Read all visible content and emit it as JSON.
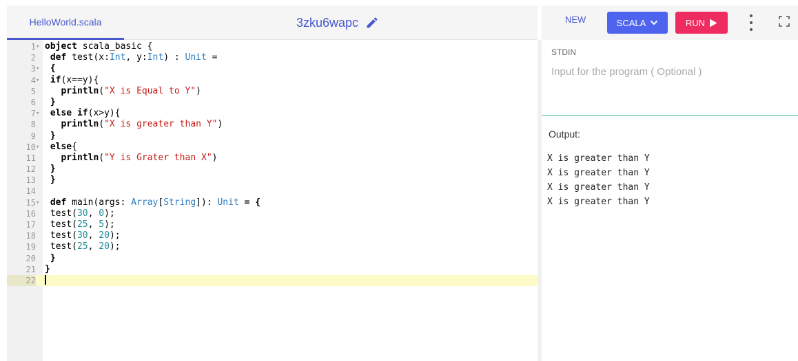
{
  "header": {
    "file_tab": "HelloWorld.scala",
    "project_name": "3zku6wapc",
    "edit_icon": "pencil-icon"
  },
  "toolbar": {
    "new_label": "NEW",
    "language_label": "SCALA",
    "run_label": "RUN",
    "colors": {
      "language": "#4e64ee",
      "run": "#ee2c62",
      "accent": "#4a59ce"
    }
  },
  "editor": {
    "active_line": 22,
    "lines": [
      {
        "n": "1",
        "fold": true
      },
      {
        "n": "2",
        "fold": false
      },
      {
        "n": "3",
        "fold": true
      },
      {
        "n": "4",
        "fold": true
      },
      {
        "n": "5",
        "fold": false
      },
      {
        "n": "6",
        "fold": false
      },
      {
        "n": "7",
        "fold": true
      },
      {
        "n": "8",
        "fold": false
      },
      {
        "n": "9",
        "fold": false
      },
      {
        "n": "10",
        "fold": true
      },
      {
        "n": "11",
        "fold": false
      },
      {
        "n": "12",
        "fold": false
      },
      {
        "n": "13",
        "fold": false
      },
      {
        "n": "14",
        "fold": false
      },
      {
        "n": "15",
        "fold": true
      },
      {
        "n": "16",
        "fold": false
      },
      {
        "n": "17",
        "fold": false
      },
      {
        "n": "18",
        "fold": false
      },
      {
        "n": "19",
        "fold": false
      },
      {
        "n": "20",
        "fold": false
      },
      {
        "n": "21",
        "fold": false
      },
      {
        "n": "22",
        "fold": false
      }
    ],
    "code": {
      "l1_kw": "object",
      "l1_rest": " scala_basic {",
      "l2_indent": " ",
      "l2_kw": "def",
      "l2_a": " test(x:",
      "l2_t1": "Int",
      "l2_b": ", y:",
      "l2_t2": "Int",
      "l2_c": ") : ",
      "l2_t3": "Unit",
      "l2_d": " =",
      "l3": " {",
      "l4_indent": " ",
      "l4_kw": "if",
      "l4_rest": "(x==y){",
      "l5_indent": "   ",
      "l5_kw": "println",
      "l5_a": "(",
      "l5_str": "\"X is Equal to Y\"",
      "l5_b": ")",
      "l6": " }",
      "l7_indent": " ",
      "l7_kw": "else if",
      "l7_rest": "(x>y){",
      "l8_indent": "   ",
      "l8_kw": "println",
      "l8_a": "(",
      "l8_str": "\"X is greater than Y\"",
      "l8_b": ")",
      "l9": " }",
      "l10_indent": " ",
      "l10_kw": "else",
      "l10_rest": "{",
      "l11_indent": "   ",
      "l11_kw": "println",
      "l11_a": "(",
      "l11_str": "\"Y is Grater than X\"",
      "l11_b": ")",
      "l12": " }",
      "l13": " }",
      "l14": "",
      "l15_indent": " ",
      "l15_kw": "def",
      "l15_a": " main(args: ",
      "l15_t1": "Array",
      "l15_b": "[",
      "l15_t2": "String",
      "l15_c": "]): ",
      "l15_t3": "Unit",
      "l15_d": " = {",
      "l16_a": " test(",
      "l16_n1": "30",
      "l16_b": ", ",
      "l16_n2": "0",
      "l16_c": ");",
      "l17_a": " test(",
      "l17_n1": "25",
      "l17_b": ", ",
      "l17_n2": "5",
      "l17_c": ");",
      "l18_a": " test(",
      "l18_n1": "30",
      "l18_b": ", ",
      "l18_n2": "20",
      "l18_c": ");",
      "l19_a": " test(",
      "l19_n1": "25",
      "l19_b": ", ",
      "l19_n2": "20",
      "l19_c": ");",
      "l20": " }",
      "l21": "}"
    }
  },
  "stdin": {
    "label": "STDIN",
    "placeholder": "Input for the program ( Optional )",
    "value": ""
  },
  "output": {
    "label": "Output:",
    "lines": [
      "X is greater than Y",
      "X is greater than Y",
      "X is greater than Y",
      "X is greater than Y"
    ]
  }
}
